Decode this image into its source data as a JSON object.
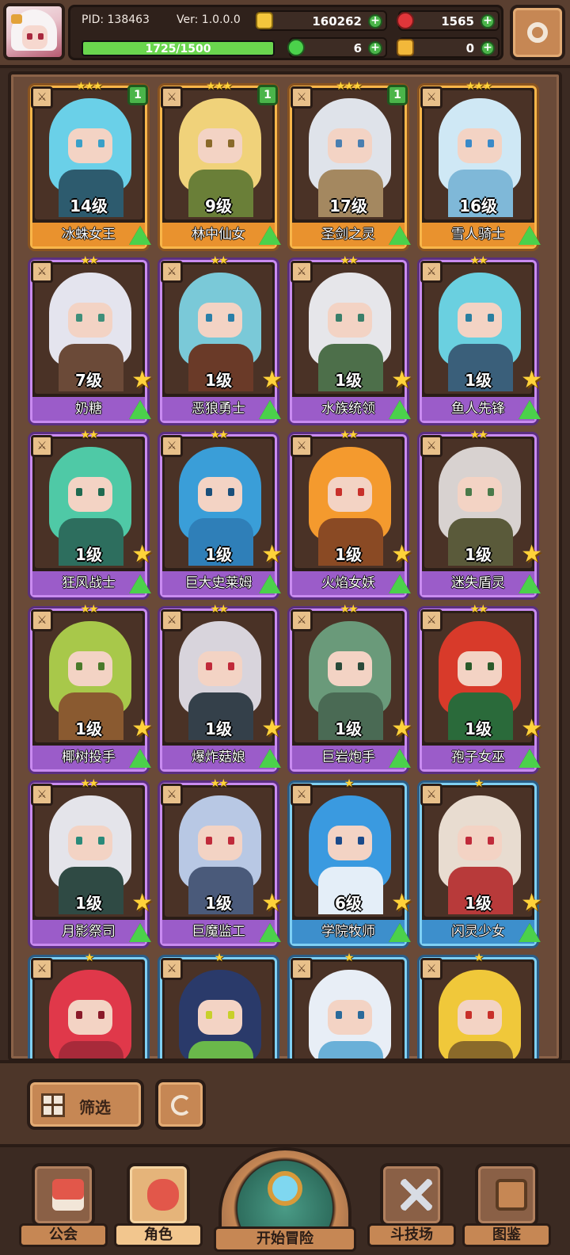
{
  "header": {
    "pid": "PID: 138463",
    "version": "Ver: 1.0.0.0",
    "gold": "160262",
    "gems": "1565",
    "clover": "6",
    "ticket": "0",
    "exp_text": "1725/1500",
    "exp_progress": 1.0,
    "colors": {
      "gold": "#f3c63c",
      "gem": "#e0363a",
      "clover": "#4bd14b",
      "ticket": "#f2b83a"
    }
  },
  "cards": [
    {
      "name": "冰蛛女王",
      "level": "14级",
      "tier": "orange",
      "stars": "★★★",
      "count": "1",
      "palette": {
        "hair": "#6ad0e8",
        "body": "#2d5b6e",
        "eye": "#3aa0c8"
      }
    },
    {
      "name": "林中仙女",
      "level": "9级",
      "tier": "orange",
      "stars": "★★★",
      "count": "1",
      "palette": {
        "hair": "#f0d27a",
        "body": "#6a7f38",
        "eye": "#8a6a2a"
      }
    },
    {
      "name": "圣剑之灵",
      "level": "17级",
      "tier": "orange",
      "stars": "★★★",
      "count": "1",
      "palette": {
        "hair": "#dfe3ea",
        "body": "#a48860",
        "eye": "#4a7fb0"
      }
    },
    {
      "name": "雪人骑士",
      "level": "16级",
      "tier": "orange",
      "stars": "★★★",
      "count": "",
      "palette": {
        "hair": "#cfe8f5",
        "body": "#7fb8d8",
        "eye": "#3a8ac8"
      }
    },
    {
      "name": "奶糖",
      "level": "7级",
      "tier": "purple",
      "stars": "★★",
      "count": "",
      "palette": {
        "hair": "#e4e4ee",
        "body": "#6b4a38",
        "eye": "#3f8f7a"
      }
    },
    {
      "name": "恶狼勇士",
      "level": "1级",
      "tier": "purple",
      "stars": "★★",
      "count": "",
      "palette": {
        "hair": "#7ac9d8",
        "body": "#6a3a28",
        "eye": "#2a7fa8"
      }
    },
    {
      "name": "水族统领",
      "level": "1级",
      "tier": "purple",
      "stars": "★★",
      "count": "",
      "palette": {
        "hair": "#e6e6ea",
        "body": "#4d6f4a",
        "eye": "#3a7f6a"
      }
    },
    {
      "name": "鱼人先锋",
      "level": "1级",
      "tier": "purple",
      "stars": "★★",
      "count": "",
      "palette": {
        "hair": "#6ad0e0",
        "body": "#3a5f7a",
        "eye": "#2a7fa0"
      }
    },
    {
      "name": "狂风战士",
      "level": "1级",
      "tier": "purple",
      "stars": "★★",
      "count": "",
      "palette": {
        "hair": "#4fc9a6",
        "body": "#2d6e5e",
        "eye": "#1f6a50"
      }
    },
    {
      "name": "巨大史莱姆",
      "level": "1级",
      "tier": "purple",
      "stars": "★★",
      "count": "",
      "palette": {
        "hair": "#3a9ed8",
        "body": "#2f7fb8",
        "eye": "#1a4f7a"
      }
    },
    {
      "name": "火焰女妖",
      "level": "1级",
      "tier": "purple",
      "stars": "★★",
      "count": "",
      "palette": {
        "hair": "#f49a2e",
        "body": "#8a4a24",
        "eye": "#c8302a"
      }
    },
    {
      "name": "迷失盾灵",
      "level": "1级",
      "tier": "purple",
      "stars": "★★",
      "count": "",
      "palette": {
        "hair": "#d8d2d0",
        "body": "#5a5a3a",
        "eye": "#4a7a4a"
      }
    },
    {
      "name": "椰树投手",
      "level": "1级",
      "tier": "purple",
      "stars": "★★",
      "count": "",
      "palette": {
        "hair": "#a8c84a",
        "body": "#8a5a30",
        "eye": "#4a7a2a"
      }
    },
    {
      "name": "爆炸菇娘",
      "level": "1级",
      "tier": "purple",
      "stars": "★★",
      "count": "",
      "palette": {
        "hair": "#d8d4dc",
        "body": "#34404a",
        "eye": "#c02a3a"
      }
    },
    {
      "name": "巨岩炮手",
      "level": "1级",
      "tier": "purple",
      "stars": "★★",
      "count": "",
      "palette": {
        "hair": "#6a9a7a",
        "body": "#4a6a54",
        "eye": "#2a4a3a"
      }
    },
    {
      "name": "孢子女巫",
      "level": "1级",
      "tier": "purple",
      "stars": "★★",
      "count": "",
      "palette": {
        "hair": "#d83a2a",
        "body": "#2a6a3a",
        "eye": "#2a5a2a"
      }
    },
    {
      "name": "月影祭司",
      "level": "1级",
      "tier": "purple",
      "stars": "★★",
      "count": "",
      "palette": {
        "hair": "#e4e4ea",
        "body": "#2f4a44",
        "eye": "#2a8a7a"
      }
    },
    {
      "name": "巨魔监工",
      "level": "1级",
      "tier": "purple",
      "stars": "★★",
      "count": "",
      "palette": {
        "hair": "#b8c8e4",
        "body": "#4a5a7a",
        "eye": "#c02a3a"
      }
    },
    {
      "name": "学院牧师",
      "level": "6级",
      "tier": "blue",
      "stars": "★",
      "count": "",
      "palette": {
        "hair": "#3a9ae0",
        "body": "#e4eef8",
        "eye": "#1a4a8a"
      }
    },
    {
      "name": "闪灵少女",
      "level": "1级",
      "tier": "blue",
      "stars": "★",
      "count": "",
      "palette": {
        "hair": "#e8dcd0",
        "body": "#b83a3a",
        "eye": "#c02a3a"
      }
    },
    {
      "name": "",
      "level": "",
      "tier": "blue",
      "stars": "★",
      "count": "",
      "palette": {
        "hair": "#e0384a",
        "body": "#a82a3a",
        "eye": "#8a1a2a"
      }
    },
    {
      "name": "",
      "level": "",
      "tier": "blue",
      "stars": "★",
      "count": "",
      "palette": {
        "hair": "#2a3a6a",
        "body": "#6ab84a",
        "eye": "#c8d02a"
      }
    },
    {
      "name": "",
      "level": "",
      "tier": "blue",
      "stars": "★",
      "count": "",
      "palette": {
        "hair": "#e8eef6",
        "body": "#6ab0d8",
        "eye": "#2a6a9a"
      }
    },
    {
      "name": "",
      "level": "",
      "tier": "blue",
      "stars": "★",
      "count": "",
      "palette": {
        "hair": "#f0c83a",
        "body": "#8a6a2a",
        "eye": "#c8302a"
      }
    }
  ],
  "filter": {
    "label": "筛选"
  },
  "nav": {
    "guild": "公会",
    "role": "角色",
    "adventure": "开始冒险",
    "arena": "斗技场",
    "codex": "图鉴"
  }
}
